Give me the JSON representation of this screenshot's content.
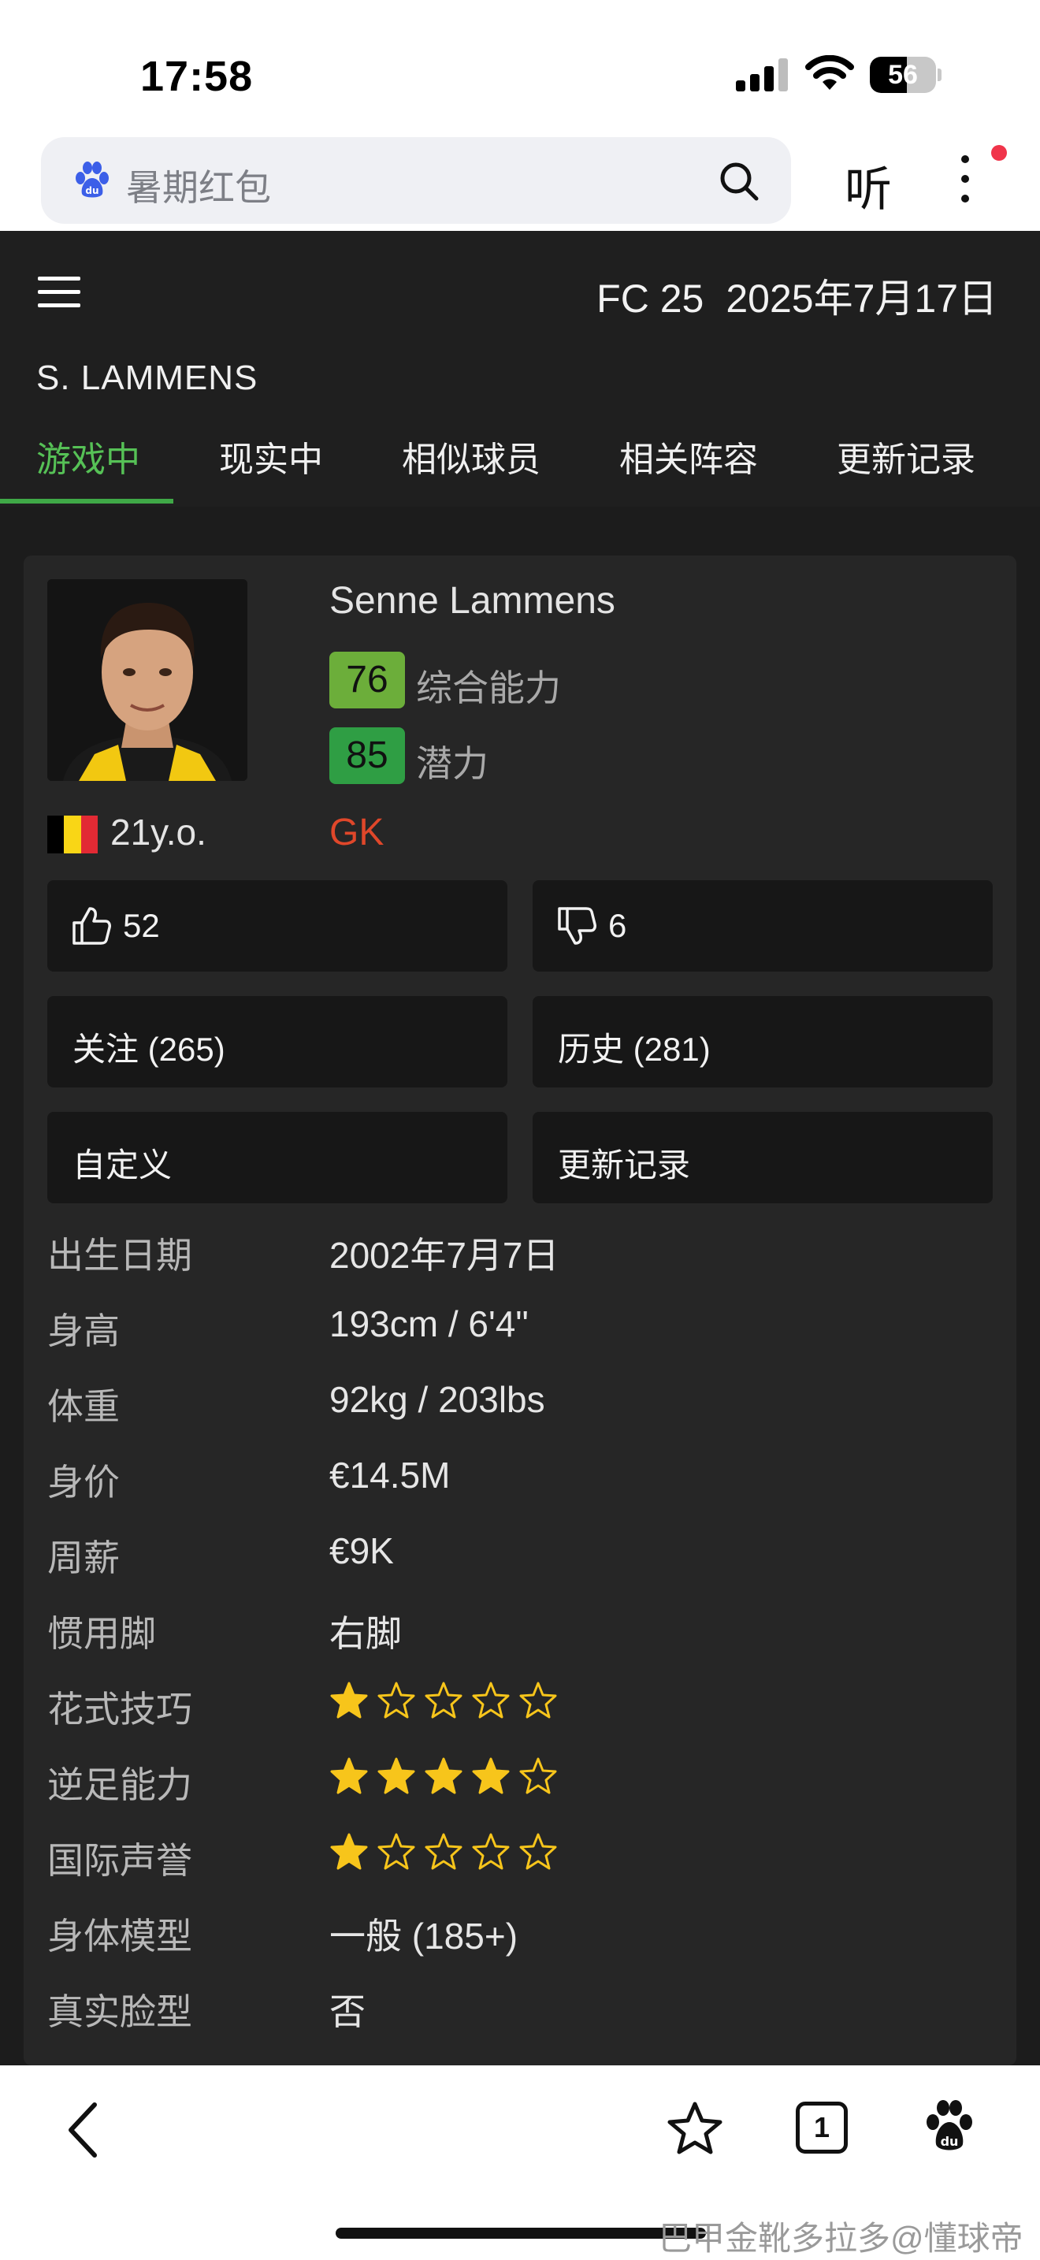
{
  "status_bar": {
    "time": "17:58",
    "battery": "56",
    "battery_level": 0.56
  },
  "browser": {
    "search_text": "暑期红包",
    "listen_label": "听",
    "tab_count": "1"
  },
  "site": {
    "header_game": "FC 25",
    "header_date": "2025年7月17日",
    "player_short_name": "S. LAMMENS",
    "tabs": [
      {
        "label": "游戏中",
        "active": true
      },
      {
        "label": "现实中",
        "active": false
      },
      {
        "label": "相似球员",
        "active": false
      },
      {
        "label": "相关阵容",
        "active": false
      },
      {
        "label": "更新记录",
        "active": false
      }
    ]
  },
  "player": {
    "full_name": "Senne Lammens",
    "overall": "76",
    "overall_label": "综合能力",
    "potential": "85",
    "potential_label": "潜力",
    "age": "21y.o.",
    "position": "GK",
    "flag_colors": [
      "#000000",
      "#f9d616",
      "#e22a34"
    ],
    "overall_color": "#6cae3a",
    "potential_color": "#2f9e44",
    "position_color": "#e0472a"
  },
  "actions": {
    "likes": "52",
    "dislikes": "6",
    "follow": "关注 (265)",
    "history": "历史 (281)",
    "custom": "自定义",
    "changelog": "更新记录"
  },
  "info": [
    {
      "label": "出生日期",
      "value": "2002年7月7日"
    },
    {
      "label": "身高",
      "value": "193cm / 6'4\""
    },
    {
      "label": "体重",
      "value": "92kg / 203lbs"
    },
    {
      "label": "身价",
      "value": "€14.5M"
    },
    {
      "label": "周薪",
      "value": "€9K"
    },
    {
      "label": "惯用脚",
      "value": "右脚"
    },
    {
      "label": "花式技巧",
      "stars": 1
    },
    {
      "label": "逆足能力",
      "stars": 4
    },
    {
      "label": "国际声誉",
      "stars": 1
    },
    {
      "label": "身体模型",
      "value": "一般 (185+)"
    },
    {
      "label": "真实脸型",
      "value": "否"
    }
  ],
  "watermark": "巴甲金靴多拉多@懂球帝"
}
